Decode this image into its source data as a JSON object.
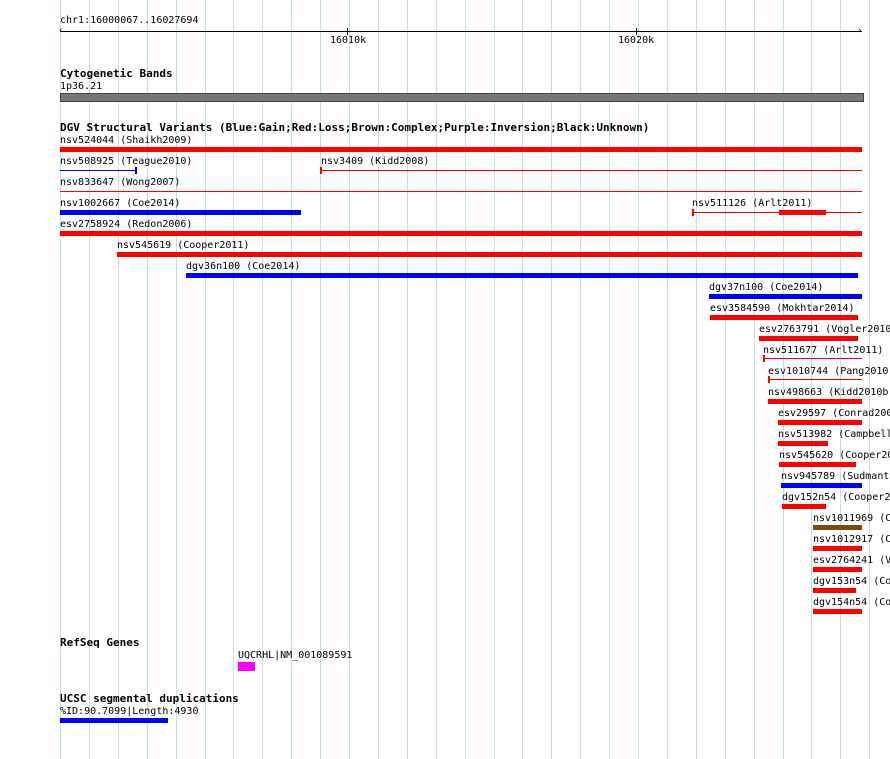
{
  "location": "chr1:16000067..16027694",
  "ruler": {
    "ticks": [
      {
        "label": "16010k"
      },
      {
        "label": "16020k"
      }
    ]
  },
  "tracks": {
    "cytoband": {
      "title": "Cytogenetic Bands",
      "band": "1p36.21"
    },
    "dgv": {
      "title": "DGV Structural Variants (Blue:Gain;Red:Loss;Brown:Complex;Purple:Inversion;Black:Unknown)",
      "features": [
        {
          "label": "nsv524044 (Shaikh2009)",
          "color": "#ff0000"
        },
        {
          "label": "nsv508925 (Teague2010)",
          "color": "#0000ff"
        },
        {
          "label": "nsv3409 (Kidd2008)",
          "color": "#ff0000"
        },
        {
          "label": "nsv833647 (Wong2007)",
          "color": "#ff0000"
        },
        {
          "label": "nsv1002667 (Coe2014)",
          "color": "#0000ff"
        },
        {
          "label": "nsv511126 (Arlt2011)",
          "color": "#ff0000"
        },
        {
          "label": "esv2758924 (Redon2006)",
          "color": "#ff0000"
        },
        {
          "label": "nsv545619 (Cooper2011)",
          "color": "#ff0000"
        },
        {
          "label": "dgv36n100 (Coe2014)",
          "color": "#0000ff"
        },
        {
          "label": "dgv37n100 (Coe2014)",
          "color": "#0000ff"
        },
        {
          "label": "esv3584590 (Mokhtar2014)",
          "color": "#ff0000"
        },
        {
          "label": "esv2763791 (Vogler2010",
          "color": "#ff0000"
        },
        {
          "label": "nsv511677 (Arlt2011)",
          "color": "#ff0000"
        },
        {
          "label": "esv1010744 (Pang2010",
          "color": "#ff0000"
        },
        {
          "label": "nsv498663 (Kidd2010b",
          "color": "#ff0000"
        },
        {
          "label": "esv29597 (Conrad200",
          "color": "#ff0000"
        },
        {
          "label": "nsv513982 (Campbell",
          "color": "#ff0000"
        },
        {
          "label": "nsv545620 (Cooper20",
          "color": "#ff0000"
        },
        {
          "label": "nsv945789 (Sudmant2",
          "color": "#0000ff"
        },
        {
          "label": "dgv152n54 (Cooper2",
          "color": "#ff0000"
        },
        {
          "label": "nsv1011969 (C",
          "color": "#7a4a10"
        },
        {
          "label": "nsv1012917 (C",
          "color": "#ff0000"
        },
        {
          "label": "esv2764241 (V",
          "color": "#ff0000"
        },
        {
          "label": "dgv153n54 (Co",
          "color": "#ff0000"
        },
        {
          "label": "dgv154n54 (Co",
          "color": "#ff0000"
        }
      ]
    },
    "refseq": {
      "title": "RefSeq Genes",
      "gene": "UQCRHL|NM_001089591",
      "color": "#ff00ff"
    },
    "segdup": {
      "title": "UCSC segmental duplications",
      "label": "%ID:90.7099|Length:4930",
      "color": "#0000ff"
    }
  }
}
